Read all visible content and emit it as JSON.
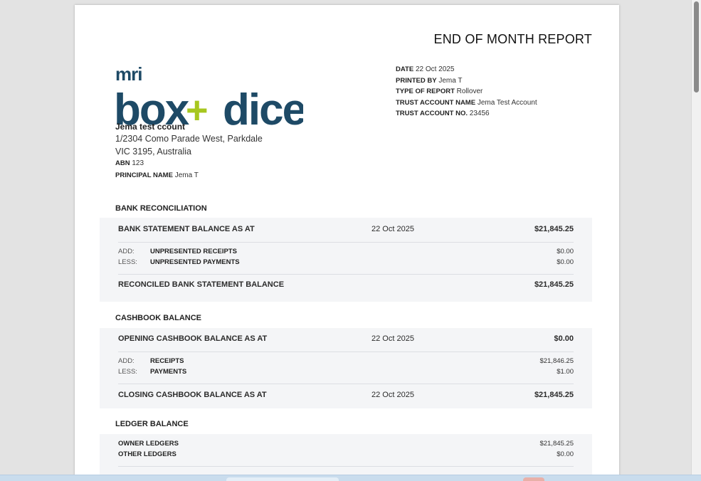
{
  "report": {
    "title": "END OF MONTH REPORT",
    "logo": {
      "top": "mri",
      "left": "box",
      "plus": "+",
      "right": "dice",
      "colors": {
        "navy": "#1e4a66",
        "green": "#a7c71f"
      }
    },
    "meta": [
      {
        "label": "DATE",
        "value": "22 Oct 2025"
      },
      {
        "label": "PRINTED BY",
        "value": "Jema T"
      },
      {
        "label": "TYPE OF REPORT",
        "value": "Rollover"
      },
      {
        "label": "TRUST ACCOUNT NAME",
        "value": "Jema Test Account"
      },
      {
        "label": "TRUST ACCOUNT NO.",
        "value": "23456"
      }
    ],
    "company": {
      "name": "Jema test ccount",
      "address_line1": "1/2304 Como Parade West, Parkdale",
      "address_line2": "VIC 3195, Australia",
      "abn_label": "ABN",
      "abn": "123",
      "principal_label": "PRINCIPAL NAME",
      "principal": "Jema T"
    }
  },
  "bank_reconciliation": {
    "title": "BANK RECONCILIATION",
    "statement_label": "BANK STATEMENT BALANCE AS AT",
    "statement_date": "22 Oct 2025",
    "statement_amount": "$21,845.25",
    "add_key": "ADD:",
    "add_label": "UNPRESENTED RECEIPTS",
    "add_amount": "$0.00",
    "less_key": "LESS:",
    "less_label": "UNPRESENTED PAYMENTS",
    "less_amount": "$0.00",
    "reconciled_label": "RECONCILED BANK STATEMENT BALANCE",
    "reconciled_amount": "$21,845.25"
  },
  "cashbook_balance": {
    "title": "CASHBOOK BALANCE",
    "opening_label": "OPENING CASHBOOK BALANCE AS AT",
    "opening_date": "22 Oct 2025",
    "opening_amount": "$0.00",
    "add_key": "ADD:",
    "add_label": "RECEIPTS",
    "add_amount": "$21,846.25",
    "less_key": "LESS:",
    "less_label": "PAYMENTS",
    "less_amount": "$1.00",
    "closing_label": "CLOSING CASHBOOK BALANCE AS AT",
    "closing_date": "22 Oct 2025",
    "closing_amount": "$21,845.25"
  },
  "ledger_balance": {
    "title": "LEDGER BALANCE",
    "owner_label": "OWNER LEDGERS",
    "owner_amount": "$21,845.25",
    "other_label": "OTHER LEDGERS",
    "other_amount": "$0.00"
  }
}
